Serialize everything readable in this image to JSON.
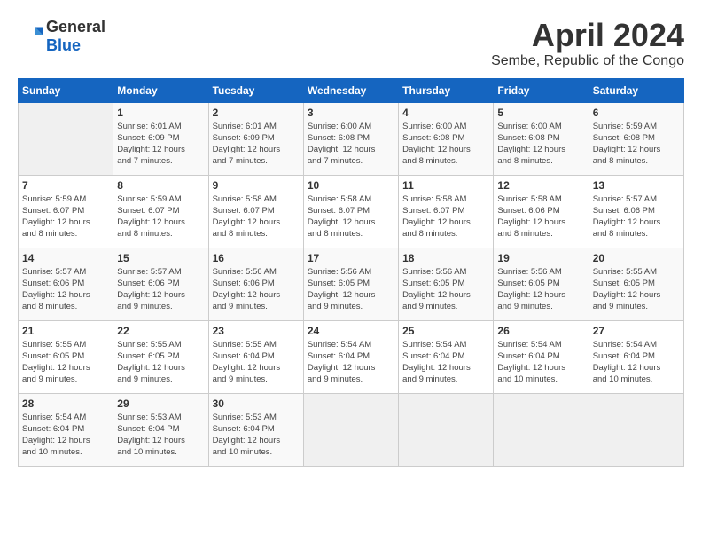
{
  "logo": {
    "general": "General",
    "blue": "Blue"
  },
  "title": {
    "month_year": "April 2024",
    "location": "Sembe, Republic of the Congo"
  },
  "days_of_week": [
    "Sunday",
    "Monday",
    "Tuesday",
    "Wednesday",
    "Thursday",
    "Friday",
    "Saturday"
  ],
  "weeks": [
    [
      {
        "day": "",
        "info": ""
      },
      {
        "day": "1",
        "info": "Sunrise: 6:01 AM\nSunset: 6:09 PM\nDaylight: 12 hours\nand 7 minutes."
      },
      {
        "day": "2",
        "info": "Sunrise: 6:01 AM\nSunset: 6:09 PM\nDaylight: 12 hours\nand 7 minutes."
      },
      {
        "day": "3",
        "info": "Sunrise: 6:00 AM\nSunset: 6:08 PM\nDaylight: 12 hours\nand 7 minutes."
      },
      {
        "day": "4",
        "info": "Sunrise: 6:00 AM\nSunset: 6:08 PM\nDaylight: 12 hours\nand 8 minutes."
      },
      {
        "day": "5",
        "info": "Sunrise: 6:00 AM\nSunset: 6:08 PM\nDaylight: 12 hours\nand 8 minutes."
      },
      {
        "day": "6",
        "info": "Sunrise: 5:59 AM\nSunset: 6:08 PM\nDaylight: 12 hours\nand 8 minutes."
      }
    ],
    [
      {
        "day": "7",
        "info": "Sunrise: 5:59 AM\nSunset: 6:07 PM\nDaylight: 12 hours\nand 8 minutes."
      },
      {
        "day": "8",
        "info": "Sunrise: 5:59 AM\nSunset: 6:07 PM\nDaylight: 12 hours\nand 8 minutes."
      },
      {
        "day": "9",
        "info": "Sunrise: 5:58 AM\nSunset: 6:07 PM\nDaylight: 12 hours\nand 8 minutes."
      },
      {
        "day": "10",
        "info": "Sunrise: 5:58 AM\nSunset: 6:07 PM\nDaylight: 12 hours\nand 8 minutes."
      },
      {
        "day": "11",
        "info": "Sunrise: 5:58 AM\nSunset: 6:07 PM\nDaylight: 12 hours\nand 8 minutes."
      },
      {
        "day": "12",
        "info": "Sunrise: 5:58 AM\nSunset: 6:06 PM\nDaylight: 12 hours\nand 8 minutes."
      },
      {
        "day": "13",
        "info": "Sunrise: 5:57 AM\nSunset: 6:06 PM\nDaylight: 12 hours\nand 8 minutes."
      }
    ],
    [
      {
        "day": "14",
        "info": "Sunrise: 5:57 AM\nSunset: 6:06 PM\nDaylight: 12 hours\nand 8 minutes."
      },
      {
        "day": "15",
        "info": "Sunrise: 5:57 AM\nSunset: 6:06 PM\nDaylight: 12 hours\nand 9 minutes."
      },
      {
        "day": "16",
        "info": "Sunrise: 5:56 AM\nSunset: 6:06 PM\nDaylight: 12 hours\nand 9 minutes."
      },
      {
        "day": "17",
        "info": "Sunrise: 5:56 AM\nSunset: 6:05 PM\nDaylight: 12 hours\nand 9 minutes."
      },
      {
        "day": "18",
        "info": "Sunrise: 5:56 AM\nSunset: 6:05 PM\nDaylight: 12 hours\nand 9 minutes."
      },
      {
        "day": "19",
        "info": "Sunrise: 5:56 AM\nSunset: 6:05 PM\nDaylight: 12 hours\nand 9 minutes."
      },
      {
        "day": "20",
        "info": "Sunrise: 5:55 AM\nSunset: 6:05 PM\nDaylight: 12 hours\nand 9 minutes."
      }
    ],
    [
      {
        "day": "21",
        "info": "Sunrise: 5:55 AM\nSunset: 6:05 PM\nDaylight: 12 hours\nand 9 minutes."
      },
      {
        "day": "22",
        "info": "Sunrise: 5:55 AM\nSunset: 6:05 PM\nDaylight: 12 hours\nand 9 minutes."
      },
      {
        "day": "23",
        "info": "Sunrise: 5:55 AM\nSunset: 6:04 PM\nDaylight: 12 hours\nand 9 minutes."
      },
      {
        "day": "24",
        "info": "Sunrise: 5:54 AM\nSunset: 6:04 PM\nDaylight: 12 hours\nand 9 minutes."
      },
      {
        "day": "25",
        "info": "Sunrise: 5:54 AM\nSunset: 6:04 PM\nDaylight: 12 hours\nand 9 minutes."
      },
      {
        "day": "26",
        "info": "Sunrise: 5:54 AM\nSunset: 6:04 PM\nDaylight: 12 hours\nand 10 minutes."
      },
      {
        "day": "27",
        "info": "Sunrise: 5:54 AM\nSunset: 6:04 PM\nDaylight: 12 hours\nand 10 minutes."
      }
    ],
    [
      {
        "day": "28",
        "info": "Sunrise: 5:54 AM\nSunset: 6:04 PM\nDaylight: 12 hours\nand 10 minutes."
      },
      {
        "day": "29",
        "info": "Sunrise: 5:53 AM\nSunset: 6:04 PM\nDaylight: 12 hours\nand 10 minutes."
      },
      {
        "day": "30",
        "info": "Sunrise: 5:53 AM\nSunset: 6:04 PM\nDaylight: 12 hours\nand 10 minutes."
      },
      {
        "day": "",
        "info": ""
      },
      {
        "day": "",
        "info": ""
      },
      {
        "day": "",
        "info": ""
      },
      {
        "day": "",
        "info": ""
      }
    ]
  ]
}
